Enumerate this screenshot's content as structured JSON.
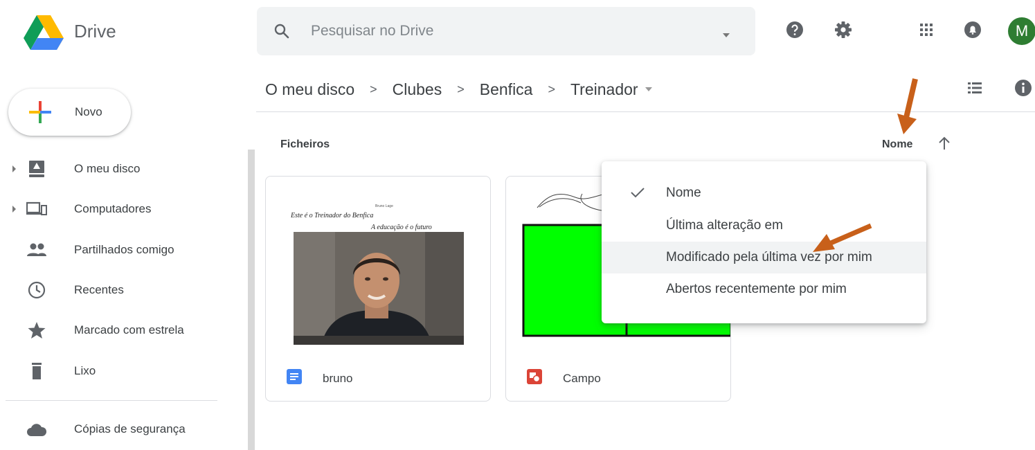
{
  "app": {
    "name": "Drive"
  },
  "search": {
    "placeholder": "Pesquisar no Drive"
  },
  "header": {
    "avatar_initial": "M"
  },
  "new_button": {
    "label": "Novo"
  },
  "sidebar": {
    "items": [
      {
        "label": "O meu disco",
        "icon": "my-drive-icon"
      },
      {
        "label": "Computadores",
        "icon": "computers-icon"
      },
      {
        "label": "Partilhados comigo",
        "icon": "shared-icon"
      },
      {
        "label": "Recentes",
        "icon": "clock-icon"
      },
      {
        "label": "Marcado com estrela",
        "icon": "star-icon"
      },
      {
        "label": "Lixo",
        "icon": "trash-icon"
      },
      {
        "label": "Cópias de segurança",
        "icon": "cloud-icon"
      }
    ]
  },
  "breadcrumb": [
    "O meu disco",
    "Clubes",
    "Benfica",
    "Treinador"
  ],
  "section": {
    "title": "Ficheiros"
  },
  "sort": {
    "label": "Nome"
  },
  "sort_menu": {
    "items": [
      "Nome",
      "Última alteração em",
      "Modificado pela última vez por mim",
      "Abertos recentemente por mim"
    ],
    "selected_index": 0,
    "hovered_index": 2
  },
  "files": [
    {
      "name": "bruno",
      "type": "document",
      "thumb_title": "Este é o Treinador do Benfica",
      "thumb_author": "Bruno Lage",
      "thumb_subtitle": "A educação é o futuro"
    },
    {
      "name": "Campo",
      "type": "drawing"
    }
  ],
  "colors": {
    "accent_arrow": "#c8601a",
    "avatar": "#2e7d32",
    "doc_icon": "#4285f4",
    "drawing_icon": "#db4437",
    "field_green": "#00ff00"
  }
}
